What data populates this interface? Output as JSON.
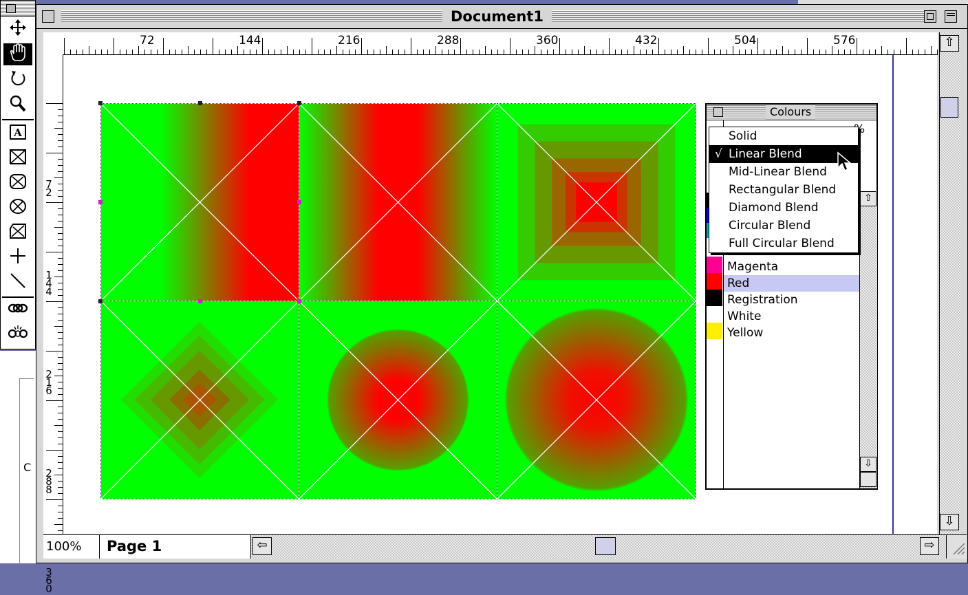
{
  "window": {
    "title": "Document1"
  },
  "ruler": {
    "horizontal_labels": [
      "72",
      "144",
      "216",
      "288",
      "360",
      "432",
      "504",
      "576"
    ],
    "vertical_labels": [
      "72",
      "144",
      "216",
      "288",
      "360"
    ]
  },
  "toolbox": {
    "tools": [
      {
        "name": "move",
        "icon": "four-arrow-move-icon"
      },
      {
        "name": "grabber",
        "icon": "grabber-hand-icon",
        "selected": true
      },
      {
        "name": "rotate",
        "icon": "rotate-icon"
      },
      {
        "name": "zoom",
        "icon": "magnifier-icon"
      },
      {
        "name": "text-box",
        "icon": "text-box-icon"
      },
      {
        "name": "picture-box-rect",
        "icon": "picture-box-rect-icon"
      },
      {
        "name": "picture-box-rounded",
        "icon": "picture-box-rounded-icon"
      },
      {
        "name": "picture-box-oval",
        "icon": "picture-box-oval-icon"
      },
      {
        "name": "picture-box-polygon",
        "icon": "picture-box-polygon-icon"
      },
      {
        "name": "orthogonal-line",
        "icon": "orthogonal-line-icon"
      },
      {
        "name": "line",
        "icon": "diagonal-line-icon"
      },
      {
        "name": "linking",
        "icon": "chain-link-icon"
      },
      {
        "name": "unlinking",
        "icon": "chain-unlink-icon"
      }
    ]
  },
  "status": {
    "zoom": "100%",
    "page": "Page 1"
  },
  "behind_window": {
    "text": "C"
  },
  "palette": {
    "title": "Colours",
    "colors": [
      {
        "name": "Magenta",
        "swatch": "#ff0090"
      },
      {
        "name": "Red",
        "swatch": "#ff0000",
        "selected": true
      },
      {
        "name": "Registration",
        "swatch": "#000000"
      },
      {
        "name": "White",
        "swatch": "#ffffff"
      },
      {
        "name": "Yellow",
        "swatch": "#ffee00"
      }
    ],
    "partial_swatches": [
      "#000000",
      "#0000ff",
      "#00aaaa"
    ],
    "percent_label": "%"
  },
  "blend_menu": {
    "checkmark": "√",
    "items": [
      {
        "label": "Solid"
      },
      {
        "label": "Linear Blend",
        "checked": true,
        "highlighted": true
      },
      {
        "label": "Mid-Linear Blend"
      },
      {
        "label": "Rectangular Blend"
      },
      {
        "label": "Diamond Blend"
      },
      {
        "label": "Circular Blend"
      },
      {
        "label": "Full Circular Blend"
      }
    ]
  },
  "blend_boxes": [
    {
      "blend": "linear",
      "from": "#00ff00",
      "to": "#ff0000"
    },
    {
      "blend": "mid-linear",
      "from": "#00ff00",
      "to": "#ff0000"
    },
    {
      "blend": "rectangular",
      "from": "#00ff00",
      "to": "#ff0000"
    },
    {
      "blend": "diamond",
      "from": "#00ff00",
      "to": "#ff0000"
    },
    {
      "blend": "circular",
      "from": "#00ff00",
      "to": "#ff0000"
    },
    {
      "blend": "full-circular",
      "from": "#00ff00",
      "to": "#ff0000"
    }
  ],
  "colors": {
    "desktop": "#6b6fa8",
    "margin_guide": "#3333aa",
    "selected_row": "#c8c8f4"
  }
}
